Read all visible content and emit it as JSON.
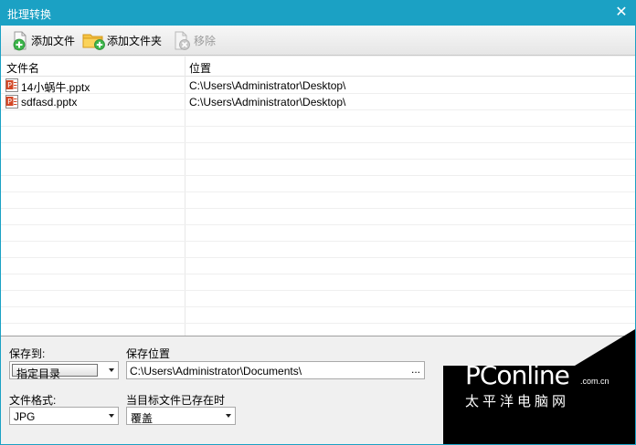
{
  "window": {
    "title": "批理转换",
    "close_glyph": "✕"
  },
  "toolbar": {
    "add_file": "添加文件",
    "add_folder": "添加文件夹",
    "remove": "移除"
  },
  "list": {
    "columns": [
      "文件名",
      "位置"
    ],
    "rows": [
      {
        "name": "14小蜗牛.pptx",
        "path": "C:\\Users\\Administrator\\Desktop\\"
      },
      {
        "name": "sdfasd.pptx",
        "path": "C:\\Users\\Administrator\\Desktop\\"
      }
    ]
  },
  "settings": {
    "save_to_label": "保存到:",
    "save_to_value": "指定目录",
    "save_location_label": "保存位置",
    "save_location_value": "C:\\Users\\Administrator\\Documents\\",
    "browse": "...",
    "format_label": "文件格式:",
    "format_value": "JPG",
    "exists_label": "当目标文件已存在时",
    "exists_value": "覆盖"
  },
  "watermark": {
    "brand": "PConline",
    "domain": ".com.cn",
    "subtitle": "太平洋电脑网"
  },
  "colors": {
    "accent": "#1ba1c4",
    "watermark_bg": "#000000"
  },
  "icons": {
    "add_file": "file-plus-icon",
    "add_folder": "folder-plus-icon",
    "remove": "file-remove-icon",
    "pptx": "pptx-file-icon"
  }
}
